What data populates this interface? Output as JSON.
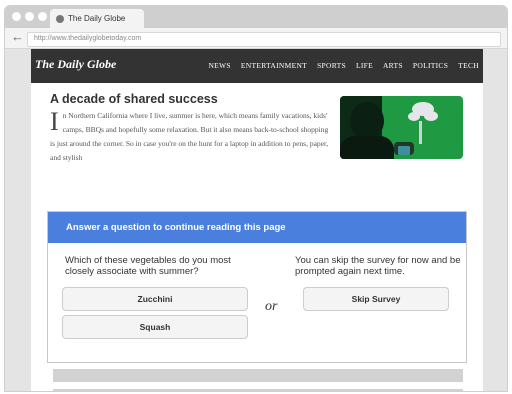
{
  "browser": {
    "tab_title": "The Daily Globe",
    "url": "http://www.thedailyglobetoday.com"
  },
  "site": {
    "logo": "The Daily Globe",
    "nav": [
      "NEWS",
      "ENTERTAINMENT",
      "SPORTS",
      "LIFE",
      "ARTS",
      "POLITICS",
      "TECH"
    ]
  },
  "article": {
    "headline": "A decade of shared success",
    "drop_cap": "I",
    "body": "n Northern California where I live, summer is here, which means family vacations, kids' camps, BBQs and hopefully some relaxation. But it also means back-to-school shopping is just around the corner. So in case you're on the hunt for a laptop in addition to pens, paper, and stylish"
  },
  "survey": {
    "title": "Answer a question to continue reading this page",
    "question": "Which of these vegetables do you most closely associate with summer?",
    "options": [
      "Zucchini",
      "Squash"
    ],
    "separator": "or",
    "skip_text": "You can skip the survey for now and be prompted again next time.",
    "skip_button": "Skip Survey"
  },
  "colors": {
    "survey_header": "#4a7fde",
    "site_header": "#333333"
  },
  "icons": {
    "back": "arrow-left-icon",
    "favicon": "globe-icon"
  }
}
